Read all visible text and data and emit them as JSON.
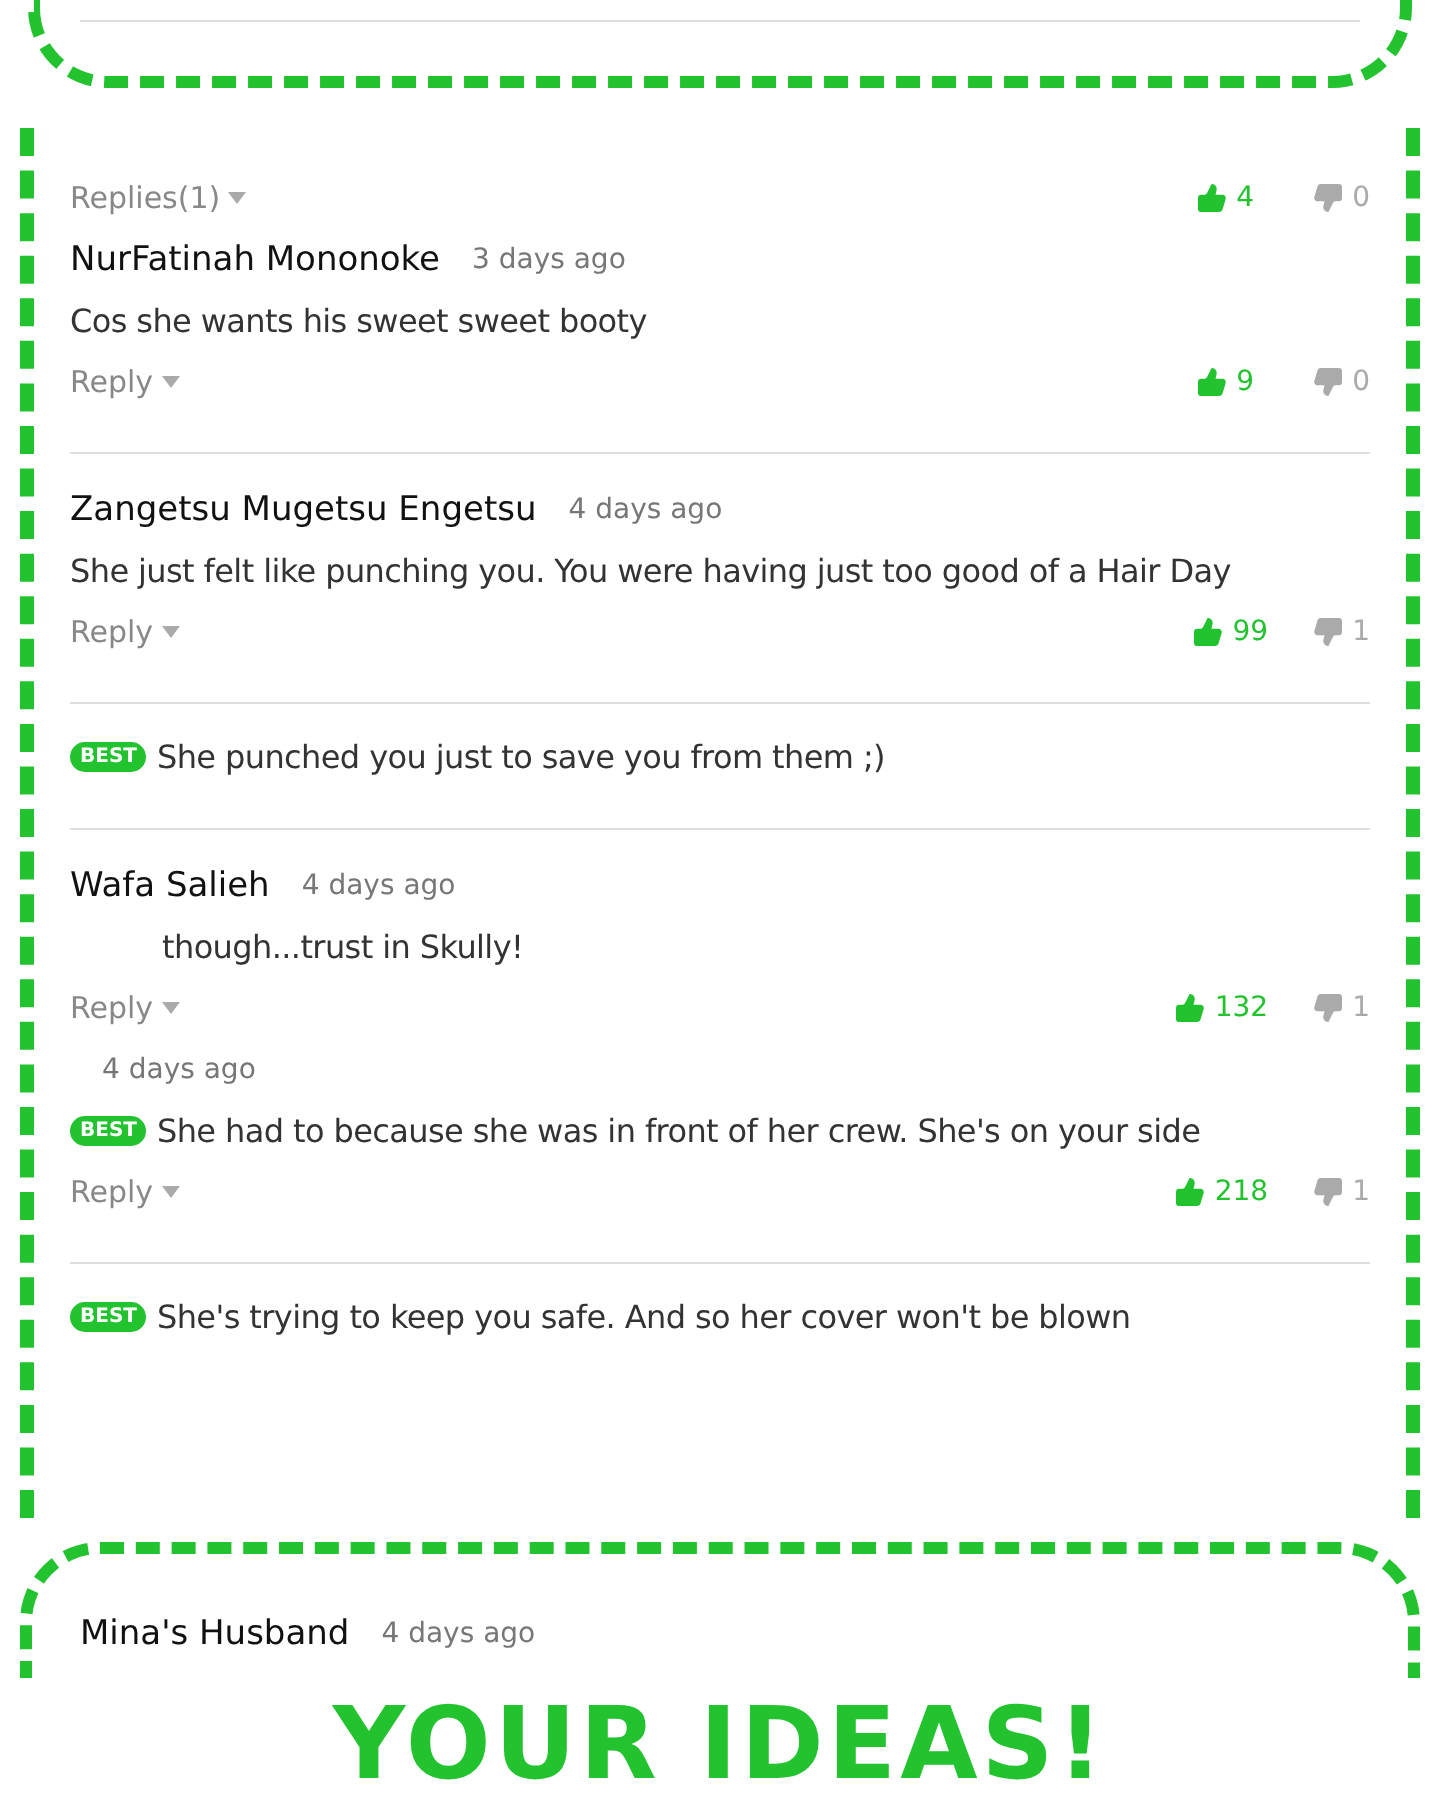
{
  "panel_items": [
    {
      "kind": "actions",
      "reply_label": "Replies(1)",
      "likes": "4",
      "dislikes": "0"
    },
    {
      "kind": "header",
      "author": "NurFatinah Mononoke",
      "time": "3 days ago"
    },
    {
      "kind": "body",
      "text": "Cos she wants his sweet sweet booty",
      "indented": false
    },
    {
      "kind": "actions",
      "reply_label": "Reply",
      "likes": "9",
      "dislikes": "0"
    },
    {
      "kind": "rule"
    },
    {
      "kind": "header",
      "author": "Zangetsu Mugetsu Engetsu",
      "time": "4 days ago"
    },
    {
      "kind": "body",
      "text": "She just felt like punching you. You were having just too good of a Hair Day",
      "indented": false
    },
    {
      "kind": "actions",
      "reply_label": "Reply",
      "likes": "99",
      "dislikes": "1"
    },
    {
      "kind": "rule"
    },
    {
      "kind": "body",
      "text": "She punched you just to save you from them ;)",
      "badge": "BEST",
      "indented": false
    },
    {
      "kind": "rule"
    },
    {
      "kind": "header",
      "author": "Wafa Salieh",
      "time": "4 days ago"
    },
    {
      "kind": "body",
      "text": "though...trust in Skully!",
      "indented": true
    },
    {
      "kind": "actions",
      "reply_label": "Reply",
      "likes": "132",
      "dislikes": "1"
    },
    {
      "kind": "header",
      "time": "4 days ago"
    },
    {
      "kind": "body",
      "text": "She had to because she was in front of her crew. She's on your side",
      "badge": "BEST",
      "indented": false
    },
    {
      "kind": "actions",
      "reply_label": "Reply",
      "likes": "218",
      "dislikes": "1"
    },
    {
      "kind": "rule"
    },
    {
      "kind": "body",
      "text": "She's trying to keep you safe. And so her cover won't be blown",
      "badge": "BEST",
      "indented": false
    }
  ],
  "last_comment": {
    "author": "Mina's Husband",
    "time": "4 days ago"
  },
  "title": "YOUR IDEAS!"
}
